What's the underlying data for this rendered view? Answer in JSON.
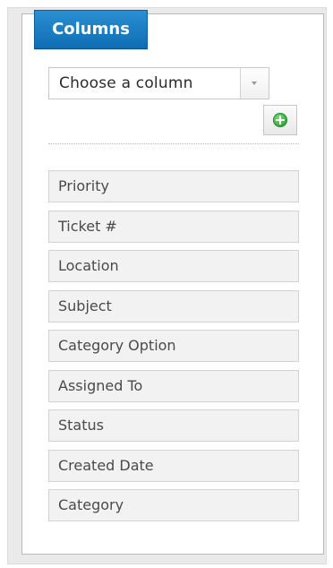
{
  "panel": {
    "title": "Columns"
  },
  "column_select": {
    "selected": "Choose a column"
  },
  "add_button": {
    "icon": "plus-circle-icon",
    "color": "#2fa23a"
  },
  "columns": [
    {
      "label": "Priority"
    },
    {
      "label": "Ticket #"
    },
    {
      "label": "Location"
    },
    {
      "label": "Subject"
    },
    {
      "label": "Category Option"
    },
    {
      "label": "Assigned To"
    },
    {
      "label": "Status"
    },
    {
      "label": "Created Date"
    },
    {
      "label": "Category"
    }
  ],
  "colors": {
    "tab_blue": "#1a7cc4",
    "item_background": "#f2f2f2",
    "item_border": "#d3d3d3"
  }
}
